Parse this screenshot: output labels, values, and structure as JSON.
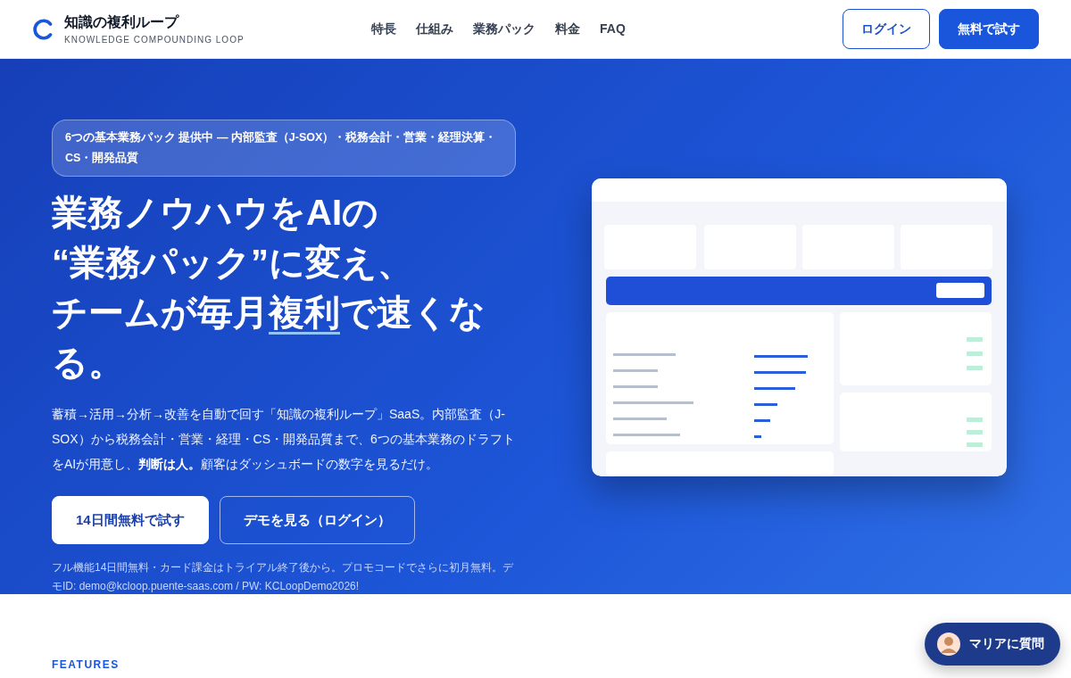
{
  "header": {
    "logo_title": "知識の複利ループ",
    "logo_subtitle": "KNOWLEDGE COMPOUNDING LOOP",
    "nav": [
      "特長",
      "仕組み",
      "業務パック",
      "料金",
      "FAQ"
    ],
    "buttons": [
      {
        "label": "ログイン",
        "kind": "outline"
      },
      {
        "label": "無料で試す",
        "kind": "primary"
      }
    ]
  },
  "hero": {
    "badge": "6つの基本業務パック 提供中 — 内部監査（J-SOX）・税務会計・営業・経理決算・CS・開発品質",
    "headline": {
      "lines": [
        "業務ノウハウをAIの",
        "“業務パック”に変え、"
      ],
      "before": "チームが毎月",
      "underlined": "複利",
      "after": "で速くなる。"
    },
    "lead": "蓄積→活用→分析→改善を自動で回す「知識の複利ループ」SaaS。内部監査（J-SOX）から税務会計・営業・経理・CS・開発品質まで、6つの基本業務のドラフトをAIが用意し、**判断は人。**顧客はダッシュボードの数字を見るだけ。",
    "buttons": [
      {
        "label": "14日間無料で試す",
        "kind": "primary"
      },
      {
        "label": "デモを見る（ログイン）",
        "kind": "outline"
      }
    ],
    "note": "フル機能14日間無料・カード課金はトライアル終了後から。プロモコードでさらに初月無料。デモID: demo@kcloop.puente-saas.com / PW: KCLoopDemo2026!"
  },
  "features_label": "FEATURES",
  "chat_button": "マリアに質問"
}
